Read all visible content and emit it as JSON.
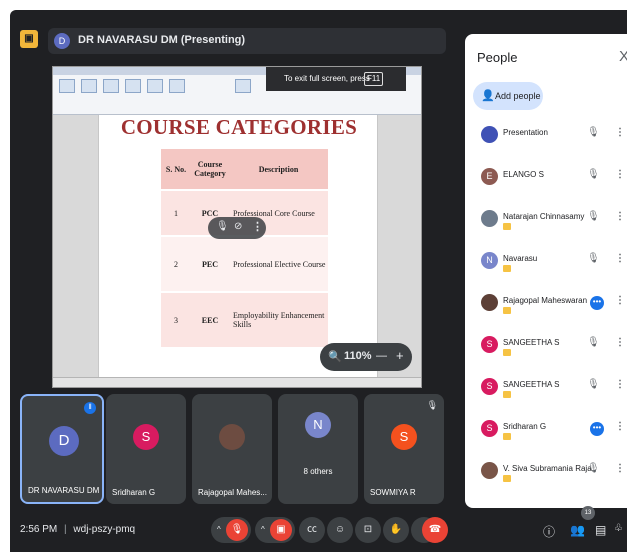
{
  "presenter": {
    "name": "DR NAVARASU DM (Presenting)",
    "avatar_letter": "D"
  },
  "fullscreen_toast": {
    "text": "To exit full screen, press",
    "key": "F11"
  },
  "slide": {
    "title": "COURSE CATEGORIES",
    "table": {
      "headers": [
        "S. No.",
        "Course Category",
        "Description"
      ],
      "rows": [
        {
          "sno": "1",
          "category": "PCC",
          "description": "Professional Core Course"
        },
        {
          "sno": "2",
          "category": "PEC",
          "description": "Professional Elective Course"
        },
        {
          "sno": "3",
          "category": "EEC",
          "description": "Employability Enhancement Skills"
        }
      ]
    }
  },
  "zoom": {
    "level": "110%",
    "minus": "—",
    "plus": "+"
  },
  "people_panel": {
    "title": "People",
    "close": "X",
    "add_people": "Add people",
    "participants": [
      {
        "name": "Presentation",
        "avatar": "",
        "color": "#3f51b5",
        "more": false
      },
      {
        "name": "ELANGO S",
        "avatar": "E",
        "color": "#8d5a52",
        "more": false
      },
      {
        "name": "Natarajan Chinnasamy",
        "avatar": "",
        "color": "#6d7b8c",
        "more": false
      },
      {
        "name": "Navarasu",
        "avatar": "N",
        "color": "#7986cb",
        "more": false
      },
      {
        "name": "Rajagopal Maheswaran",
        "avatar": "",
        "color": "#5d4037",
        "more": true
      },
      {
        "name": "SANGEETHA S",
        "avatar": "S",
        "color": "#d81b60",
        "more": false
      },
      {
        "name": "SANGEETHA S",
        "avatar": "S",
        "color": "#d81b60",
        "more": false
      },
      {
        "name": "Sridharan G",
        "avatar": "S",
        "color": "#d81b60",
        "more": true
      },
      {
        "name": "V. Siva Subramania Raja",
        "avatar": "",
        "color": "#795548",
        "more": false
      }
    ]
  },
  "tiles": [
    {
      "name": "DR NAVARASU DM",
      "avatar": "D",
      "color": "#5c6bc0"
    },
    {
      "name": "Sridharan G",
      "avatar": "S",
      "color": "#d81b60"
    },
    {
      "name": "Rajagopal Mahes...",
      "avatar": "",
      "color": "#6d4c41"
    },
    {
      "name": "8 others",
      "avatar": "N",
      "color": "#7986cb"
    },
    {
      "name": "SOWMIYA R",
      "avatar": "S",
      "color": "#f4511e"
    }
  ],
  "bottom_bar": {
    "time": "2:56 PM",
    "separator": "|",
    "meeting_code": "wdj-pszy-pmq",
    "people_count": "13"
  },
  "colors": {
    "background": "#1f2023",
    "accent": "#1a73e8",
    "end_call": "#ea4335",
    "title_red": "#9e3030",
    "table_header": "#f4c7c3",
    "table_row": "#fbe4e2"
  }
}
